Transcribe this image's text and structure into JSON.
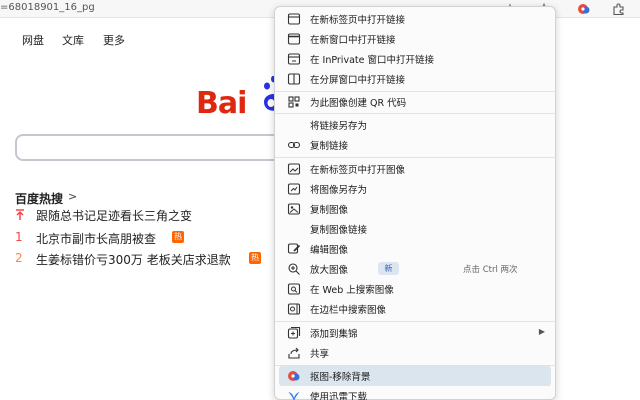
{
  "browser": {
    "address": "=68018901_16_pg"
  },
  "baidu": {
    "nav": [
      "网盘",
      "文库",
      "更多"
    ],
    "logo_text": "Bai",
    "hot_title": "百度热搜",
    "hot_items": [
      {
        "index": "↑",
        "text": "跟随总书记足迹看长三角之变",
        "badge": ""
      },
      {
        "index": "1",
        "text": "北京市副市长高朋被查",
        "badge": "热"
      },
      {
        "index": "2",
        "text": "生姜标错价亏300万 老板关店求退款",
        "badge": "热"
      }
    ]
  },
  "menu": {
    "items": [
      {
        "label": "在新标签页中打开链接",
        "icon": "new-tab-icon"
      },
      {
        "label": "在新窗口中打开链接",
        "icon": "new-window-icon"
      },
      {
        "label": "在 InPrivate 窗口中打开链接",
        "icon": "inprivate-icon"
      },
      {
        "label": "在分屏窗口中打开链接",
        "icon": "split-screen-icon"
      },
      {
        "label": "为此图像创建 QR 代码",
        "icon": "qr-code-icon"
      },
      {
        "label": "将链接另存为",
        "icon": ""
      },
      {
        "label": "复制链接",
        "icon": "link-icon"
      },
      {
        "label": "在新标签页中打开图像",
        "icon": "open-image-icon"
      },
      {
        "label": "将图像另存为",
        "icon": "save-image-icon"
      },
      {
        "label": "复制图像",
        "icon": "copy-image-icon"
      },
      {
        "label": "复制图像链接",
        "icon": ""
      },
      {
        "label": "编辑图像",
        "icon": "edit-image-icon"
      },
      {
        "label": "放大图像",
        "icon": "zoom-icon",
        "badge": "新",
        "shortcut": "点击 Ctrl 两次"
      },
      {
        "label": "在 Web 上搜索图像",
        "icon": "web-search-image-icon"
      },
      {
        "label": "在边栏中搜索图像",
        "icon": "sidebar-search-icon"
      },
      {
        "label": "添加到集锦",
        "icon": "collections-icon",
        "submenu": true
      },
      {
        "label": "共享",
        "icon": "share-icon"
      },
      {
        "label": "抠图-移除背景",
        "icon": "cutout-icon",
        "highlighted": true
      },
      {
        "label": "使用迅雷下载",
        "icon": "thunder-icon"
      }
    ]
  },
  "colors": {
    "baidu_red": "#de2910",
    "baidu_blue": "#2932e1",
    "menu_highlight": "#dbe5ee",
    "hot_badge": "#ff6600",
    "hot_top_index": "#f54545",
    "hot_second_index": "#ff8547"
  }
}
